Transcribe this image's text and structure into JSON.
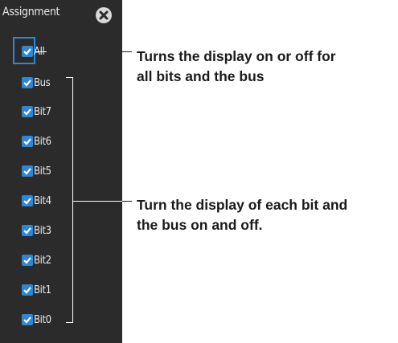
{
  "panel": {
    "title": "Assignment",
    "colors": {
      "background": "#2b2b2b",
      "accent": "#2e86d6"
    }
  },
  "checkboxes": [
    {
      "label": "All",
      "checked": true
    },
    {
      "label": "Bus",
      "checked": true
    },
    {
      "label": "Bit7",
      "checked": true
    },
    {
      "label": "Bit6",
      "checked": true
    },
    {
      "label": "Bit5",
      "checked": true
    },
    {
      "label": "Bit4",
      "checked": true
    },
    {
      "label": "Bit3",
      "checked": true
    },
    {
      "label": "Bit2",
      "checked": true
    },
    {
      "label": "Bit1",
      "checked": true
    },
    {
      "label": "Bit0",
      "checked": true
    }
  ],
  "callouts": {
    "all": {
      "line1": "Turns the display on or off for",
      "line2": "all bits and the bus"
    },
    "bits": {
      "line1": "Turn the display of each bit and",
      "line2": "the bus on and off."
    }
  }
}
